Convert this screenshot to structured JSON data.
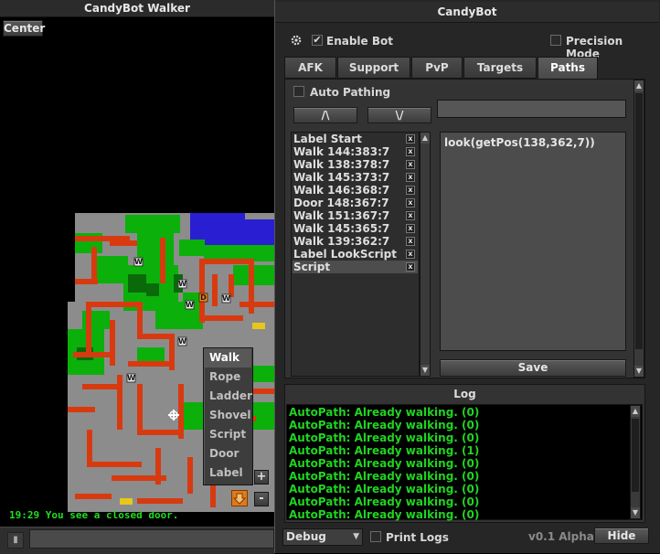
{
  "walker": {
    "title": "CandyBot Walker",
    "center_label": "Center",
    "status_text": "19:29 You see a closed door.",
    "zoom_in": "+",
    "zoom_out": "-",
    "context_menu": [
      "Walk",
      "Rope",
      "Ladder",
      "Shovel",
      "Script",
      "Door",
      "Label"
    ],
    "waypoint_marker": "W",
    "door_marker": "D",
    "chat_icon": "chat-icon"
  },
  "bot": {
    "title": "CandyBot",
    "enable_bot_label": "Enable Bot",
    "enable_bot_checked": true,
    "precision_mode_label": "Precision Mode",
    "precision_mode_checked": false,
    "tabs": [
      "AFK",
      "Support",
      "PvP",
      "Targets",
      "Paths"
    ],
    "active_tab": "Paths",
    "auto_pathing_label": "Auto Pathing",
    "auto_pathing_checked": false,
    "move_up_label": "/\\",
    "move_down_label": "\\/",
    "label_input_value": "",
    "path_items": [
      "Label Start",
      "Walk 144:383:7",
      "Walk 138:378:7",
      "Walk 145:373:7",
      "Walk 146:368:7",
      "Door 148:367:7",
      "Walk 151:367:7",
      "Walk 145:365:7",
      "Walk 139:362:7",
      "Label LookScript",
      "Script"
    ],
    "selected_path_item": "Script",
    "remove_icon_glyph": "x",
    "script_text": "look(getPos(138,362,7))",
    "save_label": "Save",
    "log_title": "Log",
    "log_lines": [
      "AutoPath: Already walking. (0)",
      "AutoPath: Already walking. (0)",
      "AutoPath: Already walking. (0)",
      "AutoPath: Already walking. (1)",
      "AutoPath: Already walking. (0)",
      "AutoPath: Already walking. (0)",
      "AutoPath: Already walking. (0)",
      "AutoPath: Already walking. (0)",
      "AutoPath: Already walking. (0)"
    ],
    "debug_select": "Debug",
    "print_logs_label": "Print Logs",
    "print_logs_checked": false,
    "version": "v0.1 Alpha",
    "hide_label": "Hide"
  },
  "colors": {
    "ground": "#8c8c8c",
    "wall": "#d83a10",
    "grass": "#0bb00b",
    "dark_grass": "#0a6a0a",
    "water": "#2a1ed2",
    "log_text": "#21d321"
  }
}
